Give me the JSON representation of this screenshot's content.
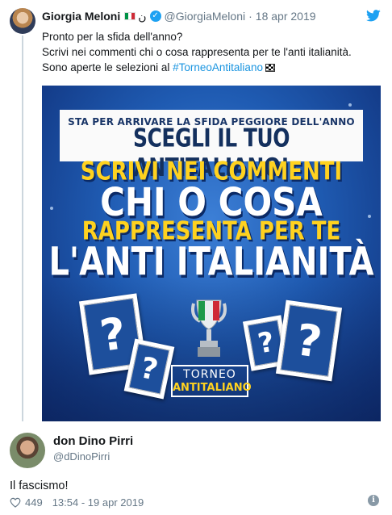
{
  "parent_tweet": {
    "author_name": "Giorgia Meloni",
    "name_glyph": "ن",
    "verified_mark": "✓",
    "handle": "@GiorgiaMeloni",
    "separator": "·",
    "date": "18 apr 2019",
    "lines": [
      "Pronto per la sfida dell'anno?",
      "Scrivi nei commenti chi o cosa rappresenta per te l'anti italianità.",
      "Sono aperte le selezioni al"
    ],
    "hashtag": "#TorneoAntitaliano",
    "icons": {
      "flag": "italy-flag-icon",
      "verified": "verified-badge-icon",
      "bird": "twitter-bird-icon",
      "checkered": "chequered-flag-icon"
    },
    "image": {
      "banner_subtitle": "STA PER ARRIVARE LA SFIDA PEGGIORE DELL'ANNO",
      "banner_title": "SCEGLI IL TUO ANTITALIANO!",
      "line1": "SCRIVI NEI COMMENTI",
      "line2": "CHI O COSA",
      "line3": "RAPPRESENTA PER TE",
      "line4": "L'ANTI ITALIANITÀ",
      "question_mark": "?",
      "logo_top": "TORNEO",
      "logo_bottom": "ANTITALIANO"
    }
  },
  "reply_tweet": {
    "author_name": "don Dino Pirri",
    "handle": "@dDinoPirri",
    "text": "Il fascismo!",
    "likes": "449",
    "timestamp": "13:54 - 19 apr 2019",
    "info_glyph": "i",
    "icons": {
      "like": "heart-icon",
      "info": "info-icon"
    }
  },
  "colors": {
    "twitter_blue": "#1da1f2",
    "link_blue": "#1b95e0",
    "muted_gray": "#657786",
    "poster_blue": "#1f5bb2",
    "poster_yellow": "#ffd21f"
  }
}
